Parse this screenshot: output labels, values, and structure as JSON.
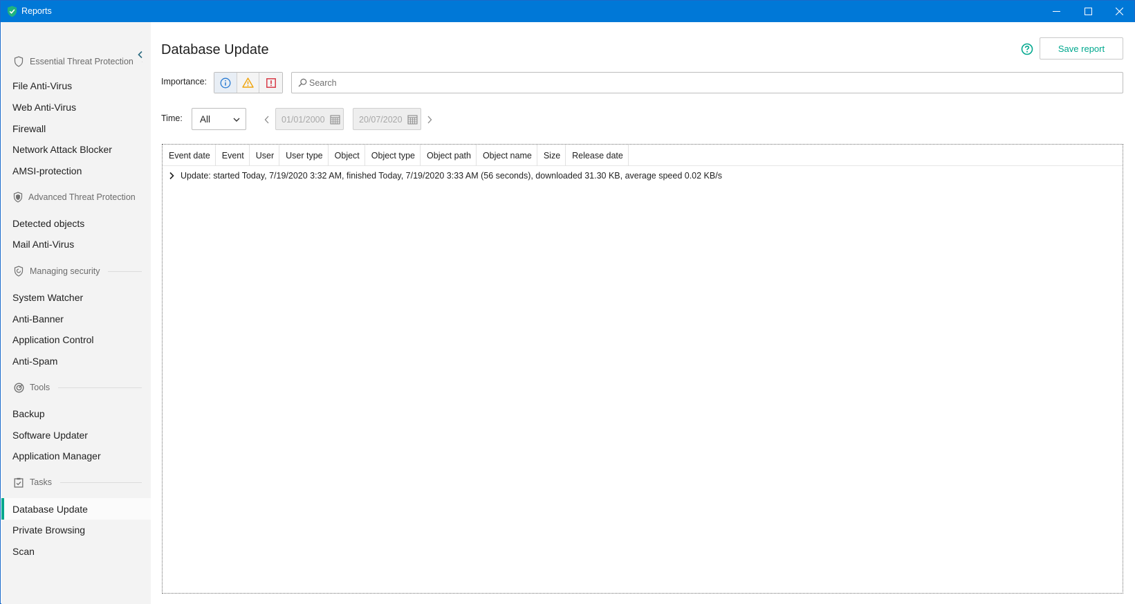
{
  "window": {
    "title": "Reports",
    "accent": "#0078d7"
  },
  "sidebar": {
    "sections": [
      {
        "label": "Essential Threat Protection",
        "icon": "shield-outline-icon",
        "items": [
          "File Anti-Virus",
          "Web Anti-Virus",
          "Firewall",
          "Network Attack Blocker",
          "AMSI-protection"
        ]
      },
      {
        "label": "Advanced Threat Protection",
        "icon": "shield-double-icon",
        "items": [
          "Detected objects",
          "Mail Anti-Virus"
        ]
      },
      {
        "label": "Managing security",
        "icon": "shield-refresh-icon",
        "items": [
          "System Watcher",
          "Anti-Banner",
          "Application Control",
          "Anti-Spam"
        ]
      },
      {
        "label": "Tools",
        "icon": "tools-gauge-icon",
        "items": [
          "Backup",
          "Software Updater",
          "Application Manager"
        ]
      },
      {
        "label": "Tasks",
        "icon": "clipboard-check-icon",
        "items": [
          "Database Update",
          "Private Browsing",
          "Scan"
        ]
      }
    ],
    "active_item": "Database Update",
    "active_color": "#00a88e"
  },
  "main": {
    "title": "Database Update",
    "save_label": "Save report",
    "importance_label": "Importance:",
    "importance_levels": [
      "info-icon",
      "warning-icon",
      "critical-icon"
    ],
    "search_placeholder": "Search",
    "search_value": "",
    "time_label": "Time:",
    "time_value": "All",
    "date_from": "01/01/2000",
    "date_to": "20/07/2020"
  },
  "table": {
    "columns": [
      "Event date",
      "Event",
      "User",
      "User type",
      "Object",
      "Object type",
      "Object path",
      "Object name",
      "Size",
      "Release date"
    ],
    "rows": [
      {
        "text": "Update: started Today, 7/19/2020 3:32 AM, finished Today, 7/19/2020 3:33 AM (56 seconds), downloaded 31.30 KB, average speed 0.02 KB/s",
        "expanded": false
      }
    ]
  }
}
